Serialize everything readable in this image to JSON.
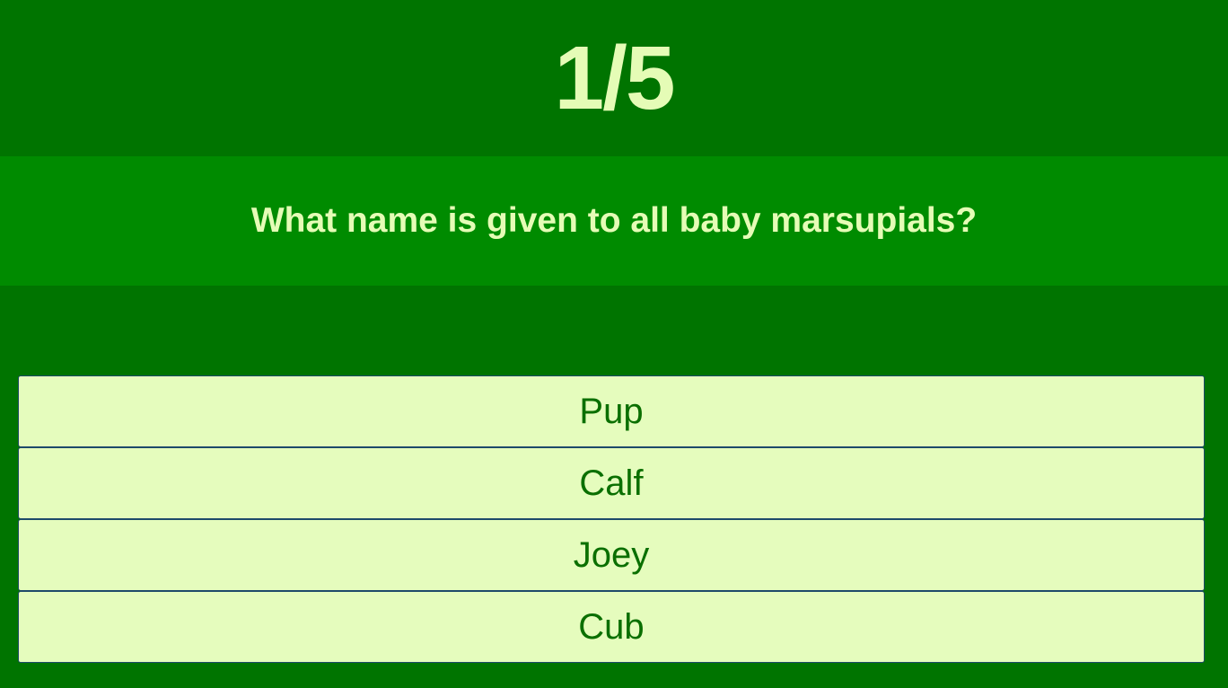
{
  "progress": {
    "text": "1/5"
  },
  "question": {
    "text": "What name is given to all baby marsupials?"
  },
  "answers": [
    {
      "label": "Pup"
    },
    {
      "label": "Calf"
    },
    {
      "label": "Joey"
    },
    {
      "label": "Cub"
    }
  ],
  "colors": {
    "background": "#007400",
    "question_band": "#008b00",
    "light_text": "#e5fcb6",
    "answer_background": "#e5fcbd",
    "answer_text": "#0a6f00",
    "answer_border": "#1d4a6a"
  }
}
